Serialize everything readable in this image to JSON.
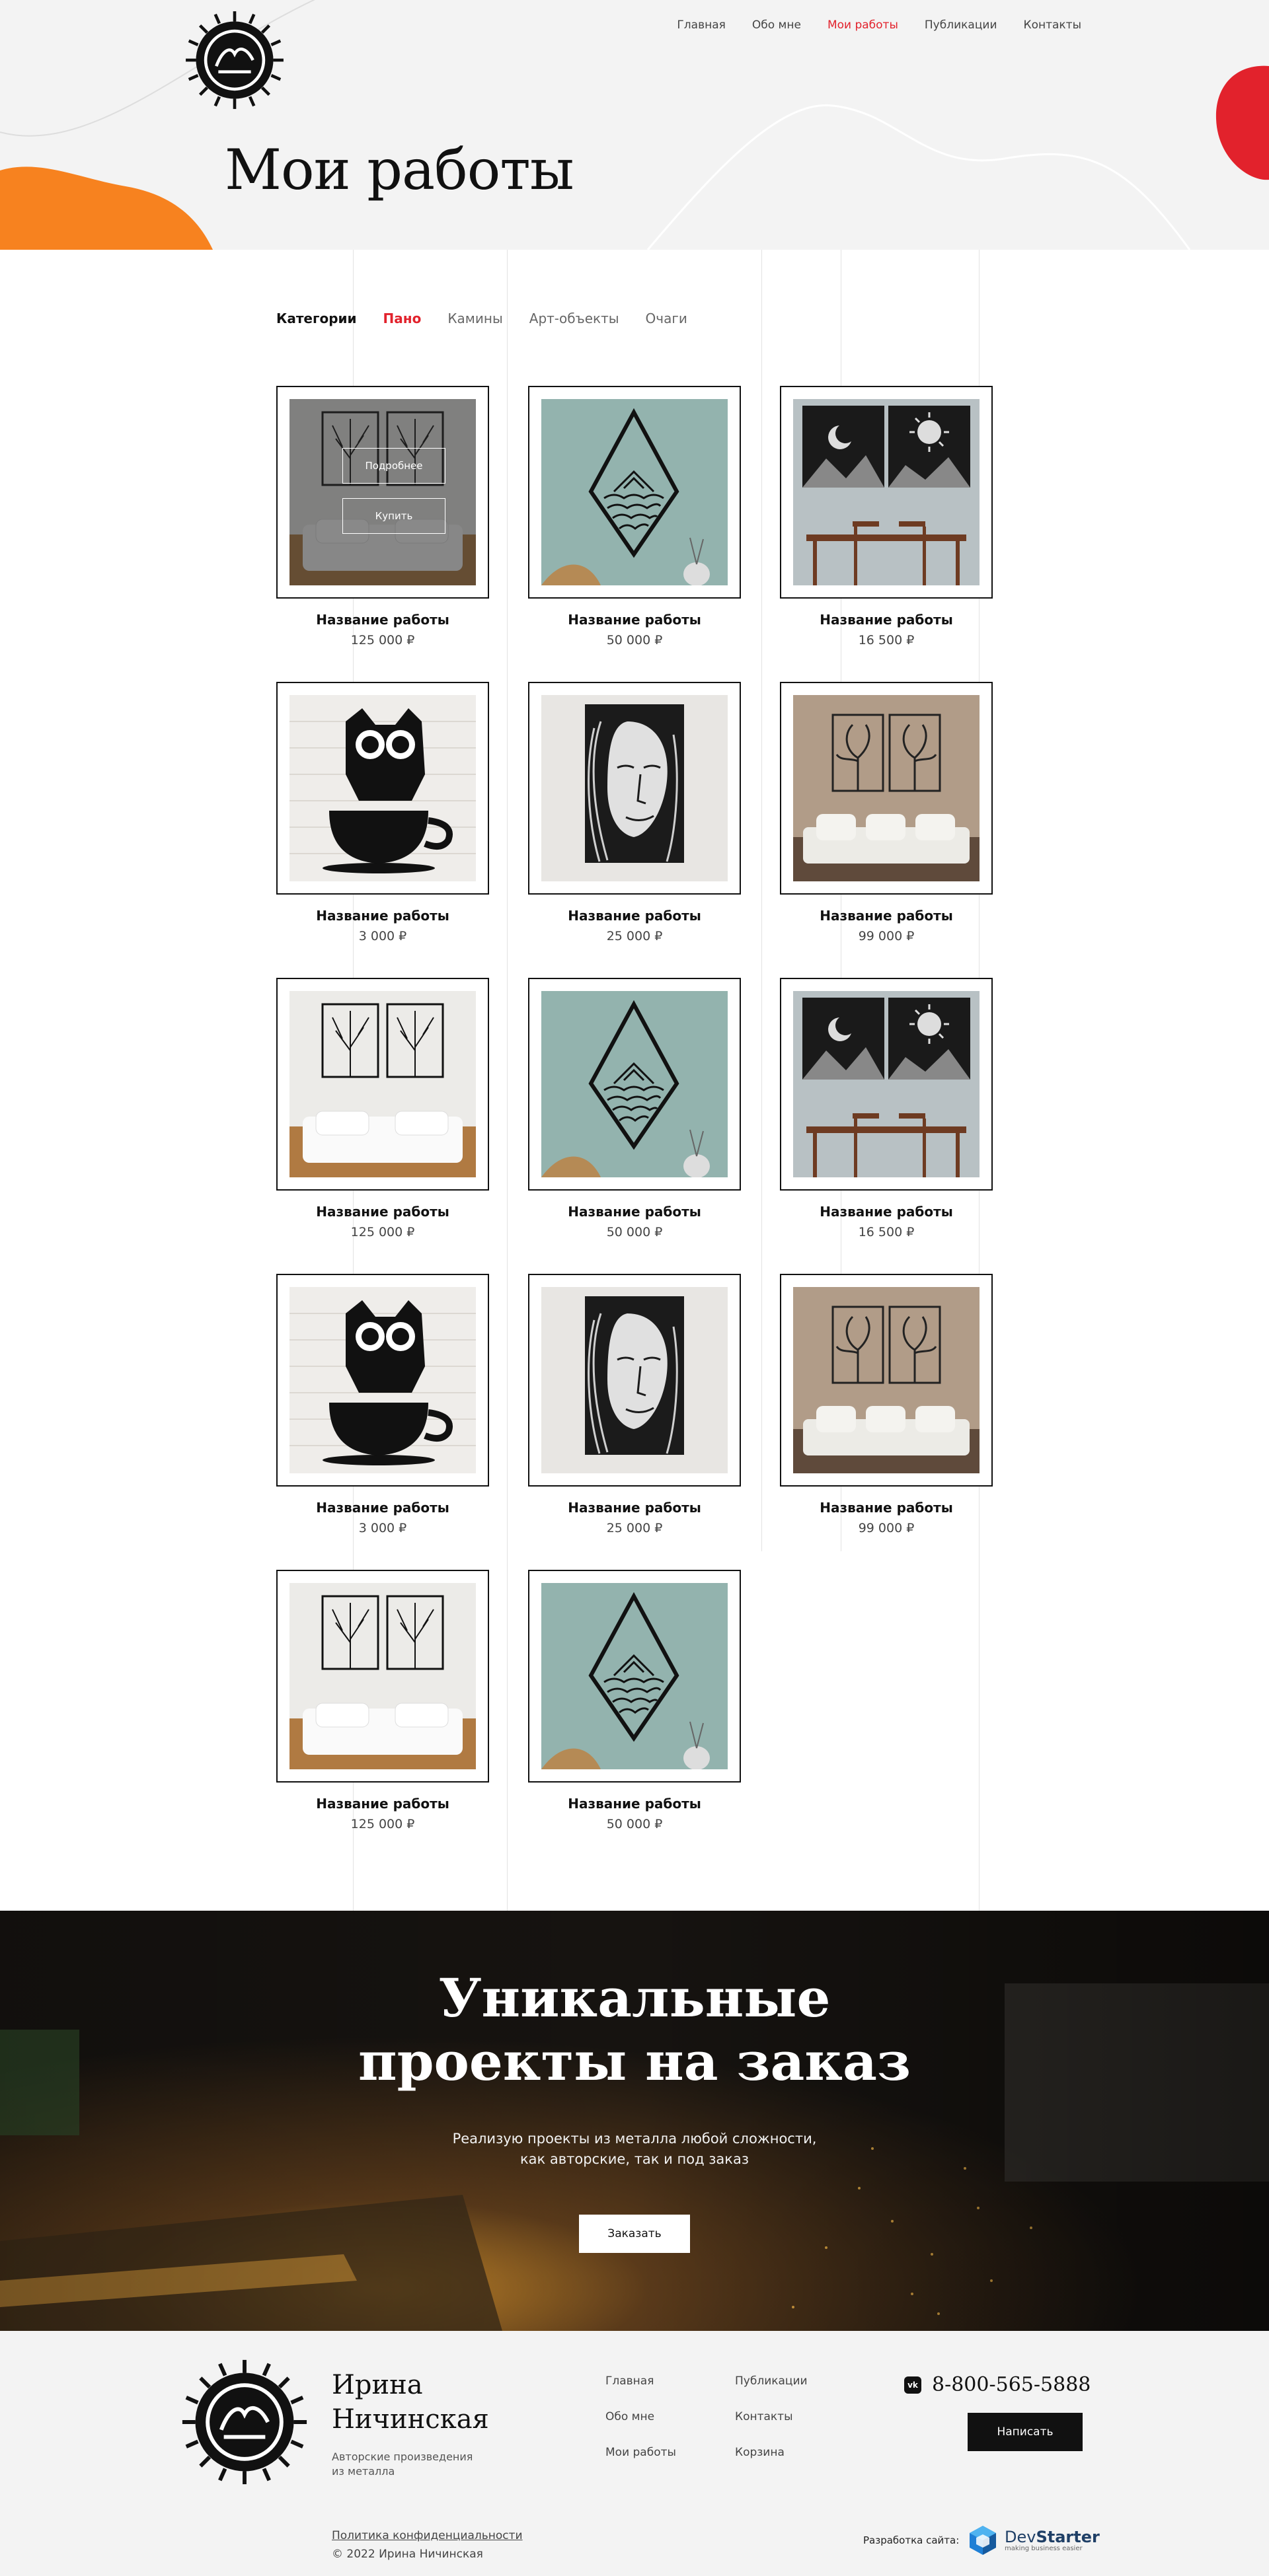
{
  "nav": {
    "items": [
      {
        "label": "Главная"
      },
      {
        "label": "Обо мне"
      },
      {
        "label": "Мои работы",
        "active": true
      },
      {
        "label": "Публикации"
      },
      {
        "label": "Контакты"
      }
    ]
  },
  "page_title": "Мои работы",
  "categories": {
    "label": "Категории",
    "items": [
      "Пано",
      "Камины",
      "Арт-объекты",
      "Очаги"
    ],
    "active": "Пано"
  },
  "products": [
    {
      "name": "Название работы",
      "price": "125 000 ₽",
      "image": "trees-diptych-bedroom"
    },
    {
      "name": "Название работы",
      "price": "50 000 ₽",
      "image": "diamond-waves"
    },
    {
      "name": "Название работы",
      "price": "16 500 ₽",
      "image": "moon-sun-diptych"
    },
    {
      "name": "Название работы",
      "price": "3 000 ₽",
      "image": "owl-cup"
    },
    {
      "name": "Название работы",
      "price": "25 000 ₽",
      "image": "woman-face"
    },
    {
      "name": "Название работы",
      "price": "99 000 ₽",
      "image": "tree-faces"
    },
    {
      "name": "Название работы",
      "price": "125 000 ₽",
      "image": "trees-diptych-bedroom"
    },
    {
      "name": "Название работы",
      "price": "50 000 ₽",
      "image": "diamond-waves"
    },
    {
      "name": "Название работы",
      "price": "16 500 ₽",
      "image": "moon-sun-diptych"
    },
    {
      "name": "Название работы",
      "price": "3 000 ₽",
      "image": "owl-cup"
    },
    {
      "name": "Название работы",
      "price": "25 000 ₽",
      "image": "woman-face"
    },
    {
      "name": "Название работы",
      "price": "99 000 ₽",
      "image": "tree-faces"
    },
    {
      "name": "Название работы",
      "price": "125 000 ₽",
      "image": "trees-diptych-bedroom"
    },
    {
      "name": "Название работы",
      "price": "50 000 ₽",
      "image": "diamond-waves"
    }
  ],
  "hover_card": {
    "details_label": "Подробнее",
    "buy_label": "Купить"
  },
  "promo": {
    "title_line1": "Уникальные",
    "title_line2": "проекты на заказ",
    "subtitle_line1": "Реализую проекты из металла любой сложности,",
    "subtitle_line2": "как авторские, так и под заказ",
    "button": "Заказать"
  },
  "footer": {
    "name_line1": "Ирина",
    "name_line2": "Ничинская",
    "desc_line1": "Авторские произведения",
    "desc_line2": "из металла",
    "col1": [
      "Главная",
      "Обо мне",
      "Мои работы"
    ],
    "col2": [
      "Публикации",
      "Контакты",
      "Корзина"
    ],
    "phone": "8-800-565-5888",
    "vk_icon": "vk-icon",
    "write_button": "Написать",
    "policy": "Политика конфиденциальности",
    "copyright": "© 2022 Ирина Ничинская",
    "dev_label": "Разработка сайта:",
    "dev_brand_a": "Dev",
    "dev_brand_b": "Starter",
    "dev_tagline": "making business easier"
  },
  "colors": {
    "accent": "#e2222c",
    "orange": "#f7821f",
    "dark": "#111111",
    "bg": "#f3f3f3"
  }
}
